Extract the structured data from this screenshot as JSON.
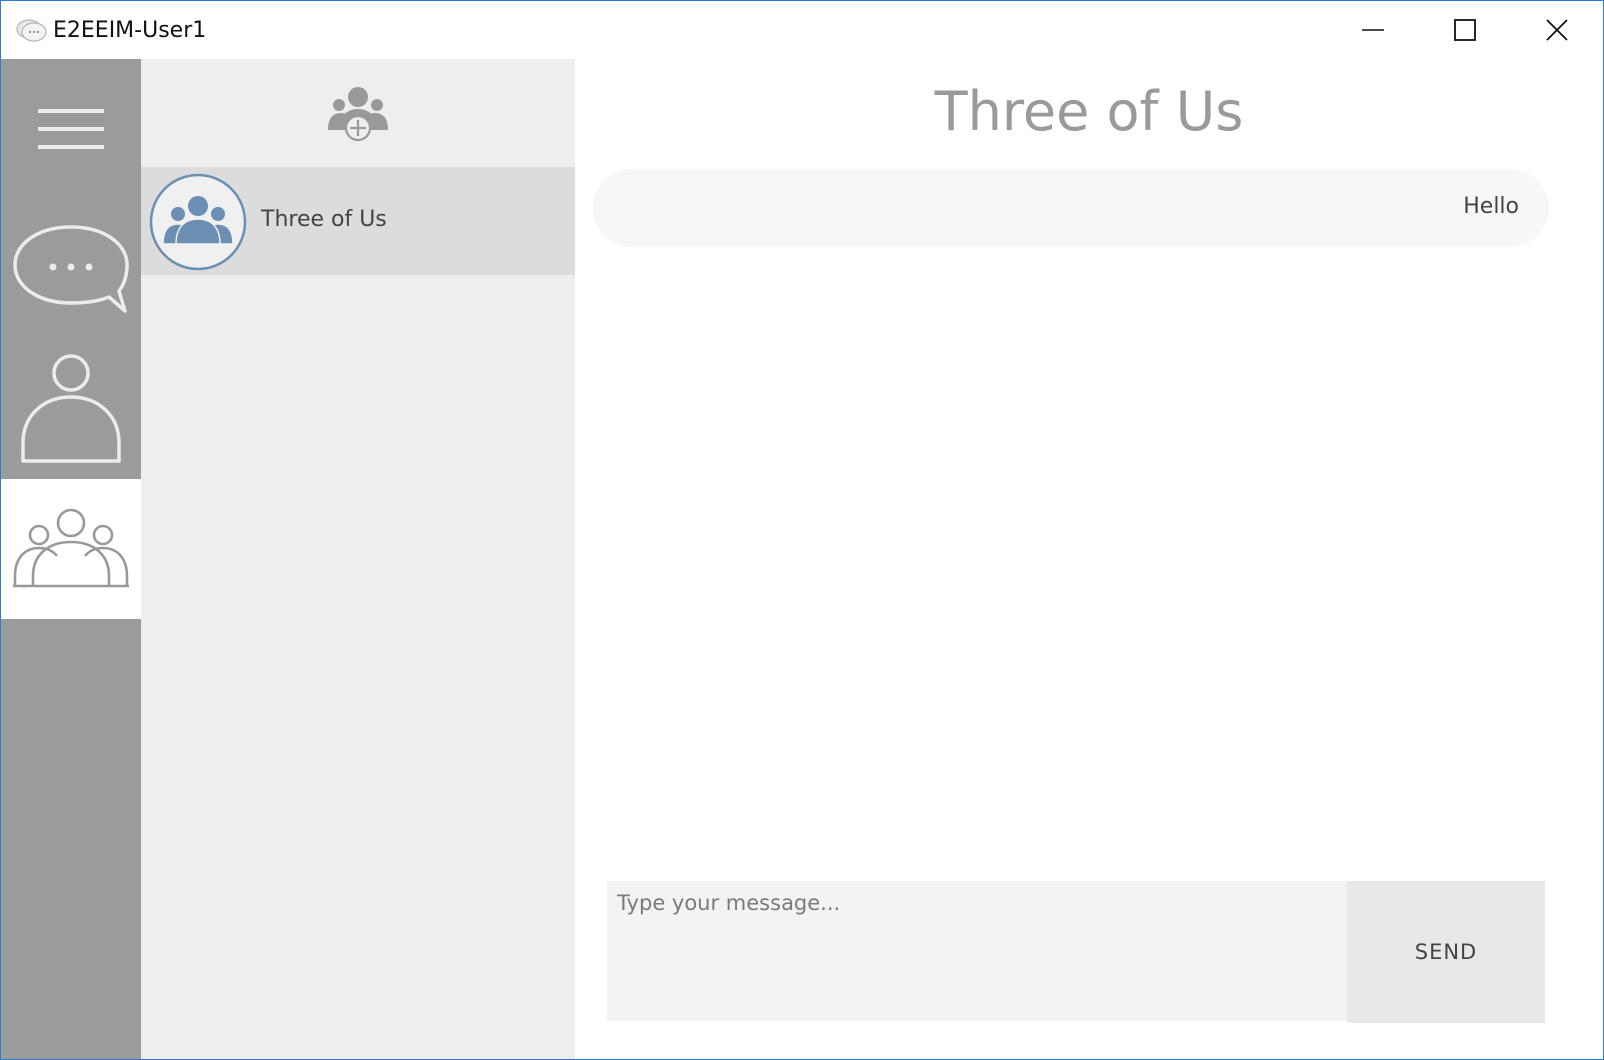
{
  "window": {
    "title": "E2EEIM-User1",
    "controls": {
      "minimize": "minimize-icon",
      "maximize": "maximize-icon",
      "close": "close-icon"
    }
  },
  "nav_rail": {
    "items": [
      {
        "id": "menu",
        "icon": "hamburger-menu-icon",
        "active": false
      },
      {
        "id": "chats",
        "icon": "chat-bubble-icon",
        "active": false
      },
      {
        "id": "contacts",
        "icon": "person-icon",
        "active": false
      },
      {
        "id": "groups",
        "icon": "group-icon",
        "active": true
      }
    ],
    "colors": {
      "background": "#9b9b9b",
      "active_background": "#ffffff"
    }
  },
  "group_list": {
    "add_button_icon": "add-group-icon",
    "groups": [
      {
        "name": "Three of Us",
        "avatar_icon": "group-avatar-icon",
        "selected": true
      }
    ],
    "colors": {
      "background": "#eeeeee",
      "selected_background": "#dcdcdc",
      "avatar_accent": "#6b8fb3"
    }
  },
  "chat": {
    "title": "Three of Us",
    "messages": [
      {
        "text": "Hello",
        "align": "right"
      }
    ],
    "composer": {
      "placeholder": "Type your message...",
      "value": "",
      "send_label": "SEND"
    }
  }
}
